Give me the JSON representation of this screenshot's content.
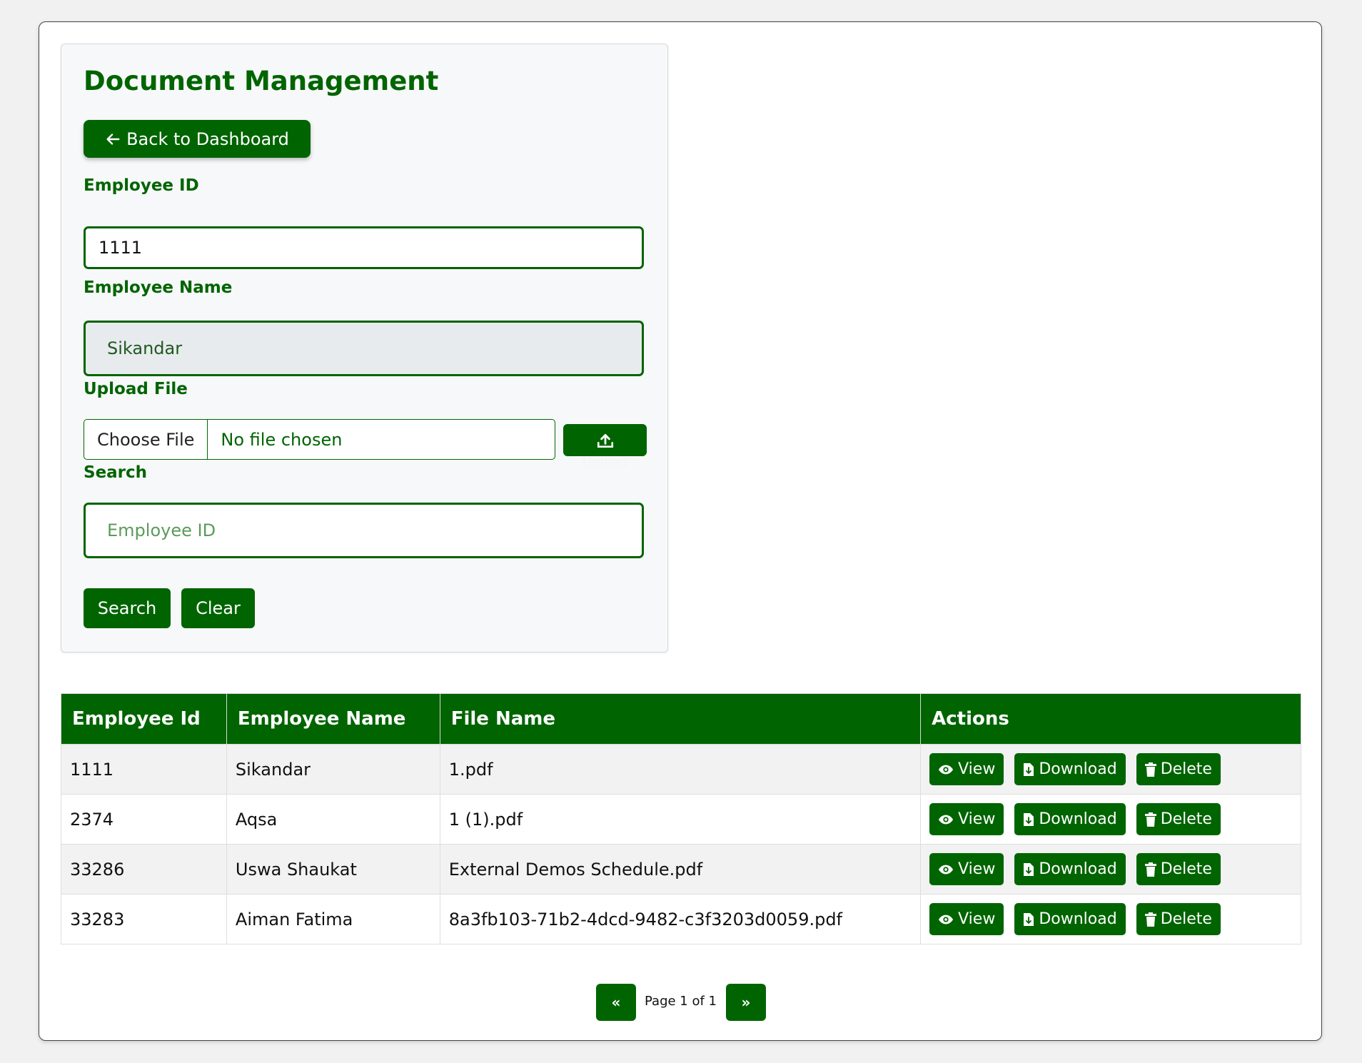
{
  "form": {
    "title": "Document Management",
    "back_button": "Back to Dashboard",
    "employee_id_label": "Employee ID",
    "employee_id_value": "1111",
    "employee_name_label": "Employee Name",
    "employee_name_value": "Sikandar",
    "upload_label": "Upload File",
    "choose_file": "Choose File",
    "file_status": "No file chosen",
    "upload_button": "Upload",
    "search_label": "Search",
    "search_placeholder": "Employee ID",
    "search_button": "Search",
    "clear_button": "Clear"
  },
  "table": {
    "headers": [
      "Employee Id",
      "Employee Name",
      "File Name",
      "Actions"
    ],
    "rows": [
      {
        "id": "1111",
        "name": "Sikandar",
        "file": "1.pdf"
      },
      {
        "id": "2374",
        "name": "Aqsa",
        "file": "1 (1).pdf"
      },
      {
        "id": "33286",
        "name": "Uswa Shaukat",
        "file": "External Demos Schedule.pdf"
      },
      {
        "id": "33283",
        "name": "Aiman Fatima",
        "file": "8a3fb103-71b2-4dcd-9482-c3f3203d0059.pdf"
      }
    ],
    "actions": {
      "view": "View",
      "download": "Download",
      "delete": "Delete"
    }
  },
  "pagination": {
    "prev": "«",
    "next": "»",
    "info": "Page 1 of 1"
  },
  "colors": {
    "primary": "#006400",
    "background": "#f1f1f1"
  }
}
